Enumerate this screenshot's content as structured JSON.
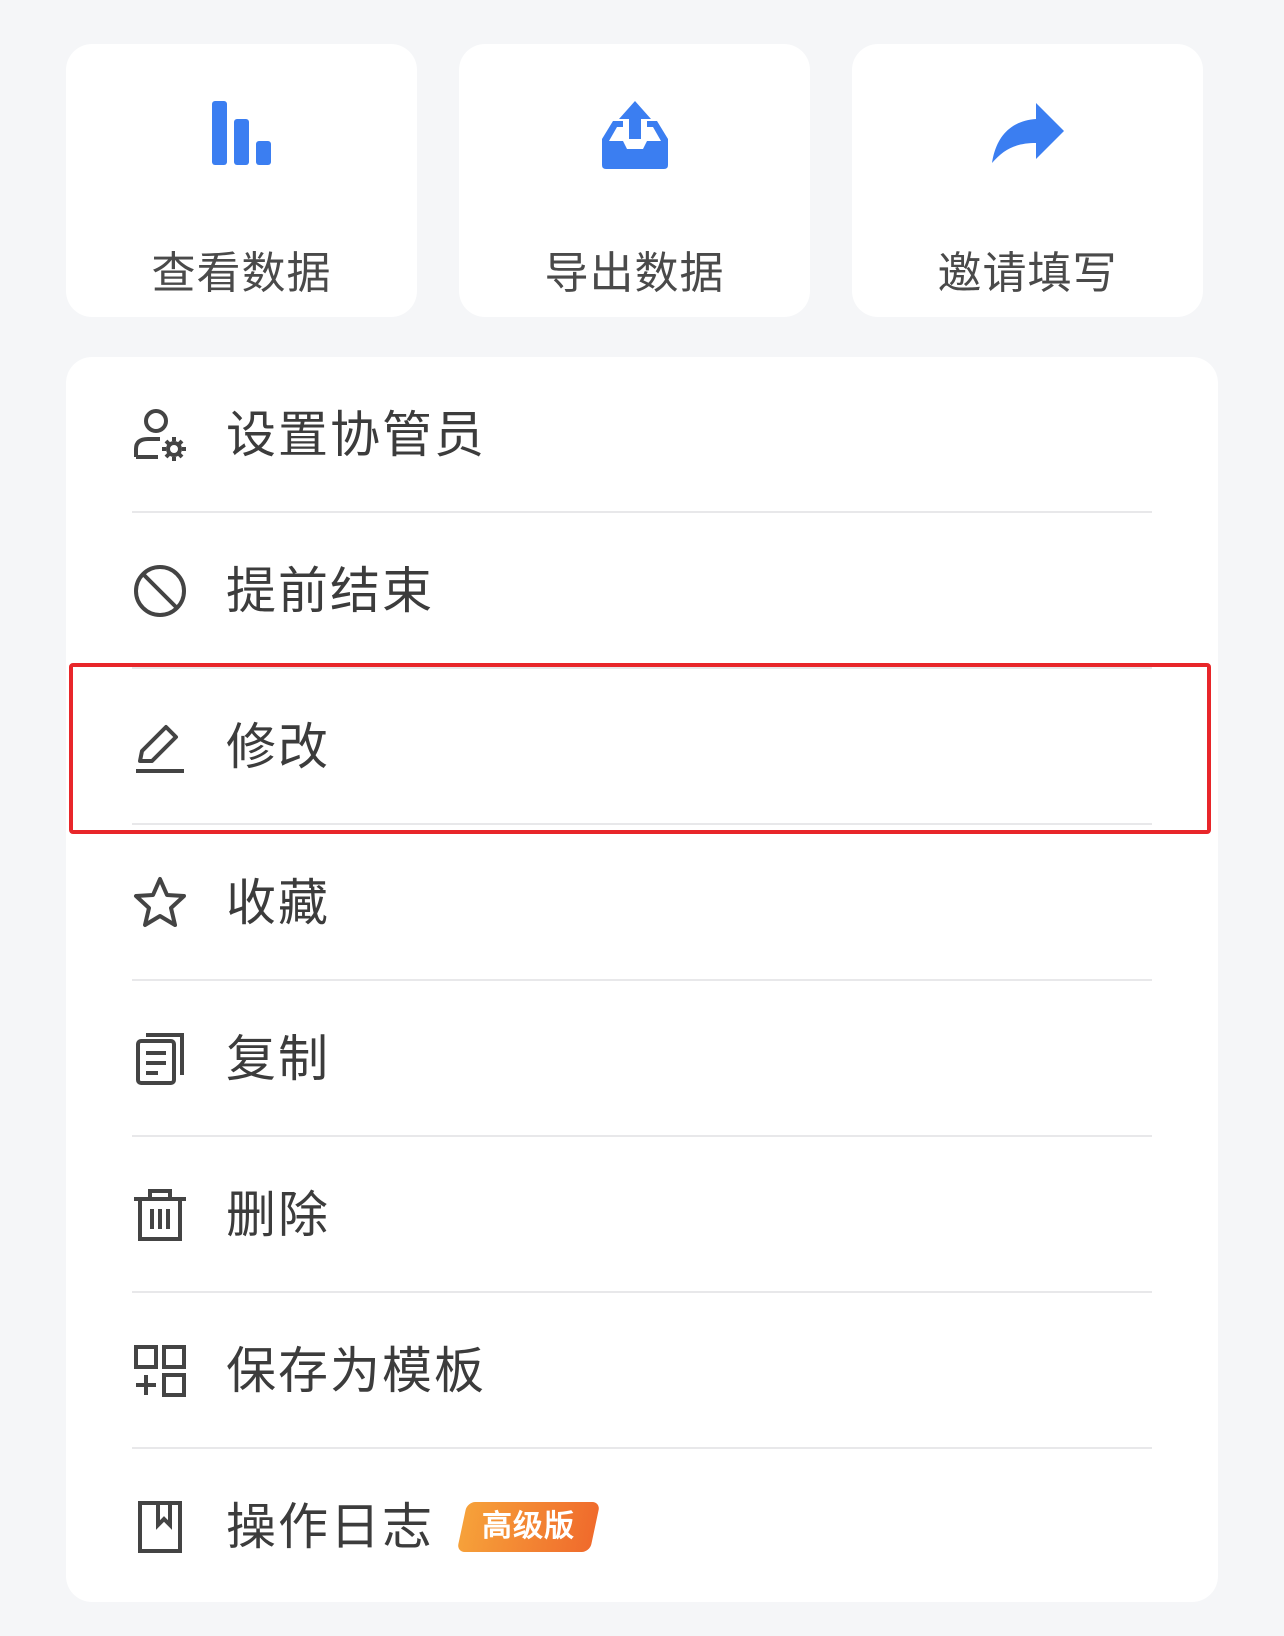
{
  "colors": {
    "accent": "#3b7ef1",
    "text": "#3c3c3c",
    "icon": "#444444",
    "highlight": "#e8262a",
    "badge_start": "#f6a13a",
    "badge_end": "#f06b2c"
  },
  "actions": [
    {
      "label": "查看数据",
      "icon": "bar-chart-icon"
    },
    {
      "label": "导出数据",
      "icon": "export-icon"
    },
    {
      "label": "邀请填写",
      "icon": "share-arrow-icon"
    }
  ],
  "menu": {
    "items": [
      {
        "label": "设置协管员",
        "icon": "user-gear-icon"
      },
      {
        "label": "提前结束",
        "icon": "ban-icon"
      },
      {
        "label": "修改",
        "icon": "pencil-icon",
        "highlighted": true
      },
      {
        "label": "收藏",
        "icon": "star-icon"
      },
      {
        "label": "复制",
        "icon": "copy-icon"
      },
      {
        "label": "删除",
        "icon": "trash-icon"
      },
      {
        "label": "保存为模板",
        "icon": "template-icon"
      },
      {
        "label": "操作日志",
        "icon": "log-book-icon",
        "badge": "高级版"
      }
    ]
  }
}
